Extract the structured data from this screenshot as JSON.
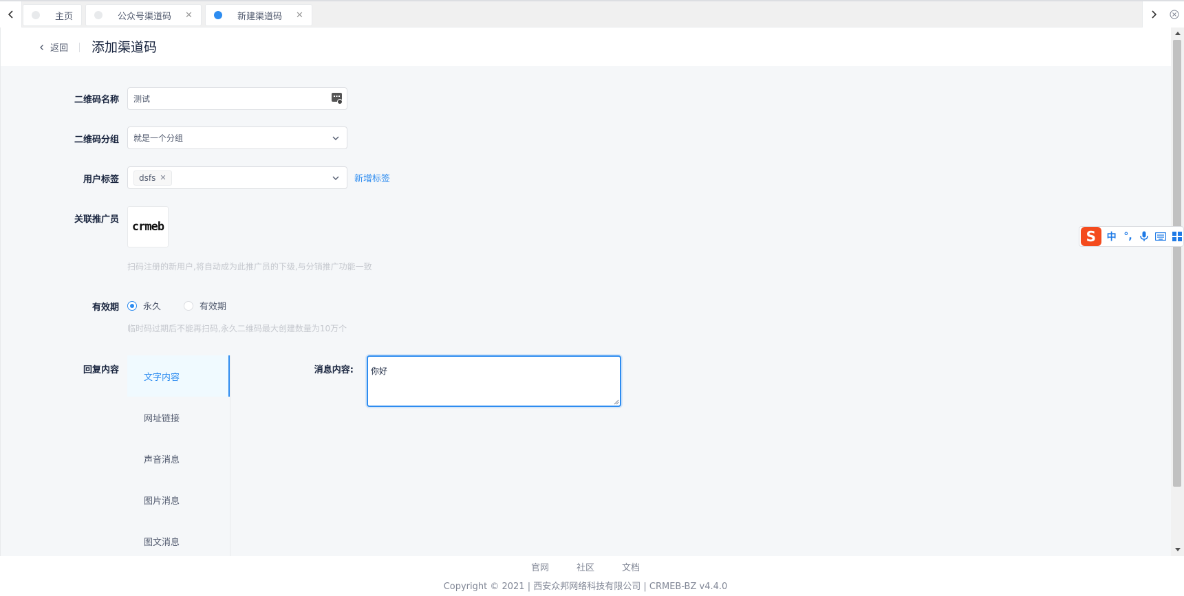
{
  "tabs": [
    {
      "label": "主页",
      "closable": false,
      "active": false
    },
    {
      "label": "公众号渠道码",
      "closable": true,
      "active": false
    },
    {
      "label": "新建渠道码",
      "closable": true,
      "active": true
    }
  ],
  "header": {
    "back_label": "返回",
    "title": "添加渠道码"
  },
  "form": {
    "name_label": "二维码名称",
    "name_value": "测试",
    "group_label": "二维码分组",
    "group_value": "就是一个分组",
    "tags_label": "用户标签",
    "tags": [
      "dsfs"
    ],
    "add_tag_link": "新增标签",
    "promoter_label": "关联推广员",
    "promoter_logo_text": "crmeb",
    "promoter_hint": "扫码注册的新用户,将自动成为此推广员的下级,与分销推广功能一致",
    "validity_label": "有效期",
    "validity_options": [
      "永久",
      "有效期"
    ],
    "validity_selected": "永久",
    "validity_hint": "临时码过期后不能再扫码,永久二维码最大创建数量为10万个",
    "reply_label": "回复内容",
    "reply_types": [
      "文字内容",
      "网址链接",
      "声音消息",
      "图片消息",
      "图文消息"
    ],
    "reply_selected": "文字内容",
    "message_label": "消息内容:",
    "message_value": "你好"
  },
  "footer": {
    "links": [
      "官网",
      "社区",
      "文档"
    ],
    "copyright": "Copyright © 2021 | 西安众邦网络科技有限公司 | CRMEB-BZ v4.4.0"
  },
  "ime": {
    "items": [
      "中",
      "°,"
    ]
  },
  "colors": {
    "accent": "#2d8cf0",
    "ime_logo": "#f44b1e"
  }
}
